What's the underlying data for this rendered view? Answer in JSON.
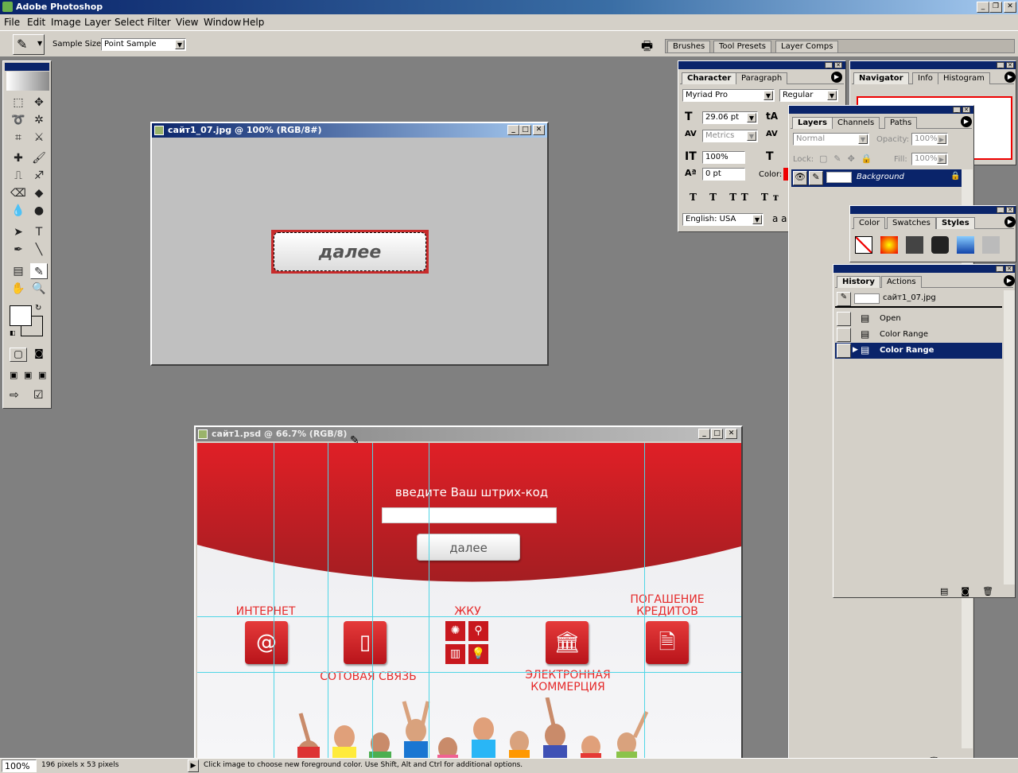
{
  "app": {
    "title": "Adobe Photoshop"
  },
  "menu": [
    "File",
    "Edit",
    "Image",
    "Layer",
    "Select",
    "Filter",
    "View",
    "Window",
    "Help"
  ],
  "options": {
    "sample_size_label": "Sample Size:",
    "sample_size_value": "Point Sample"
  },
  "dock_tabs": [
    "Brushes",
    "Tool Presets",
    "Layer Comps"
  ],
  "doc1": {
    "title": "сайт1_07.jpg @ 100% (RGB/8#)",
    "button_text": "далее"
  },
  "doc2": {
    "title": "сайт1.psd @ 66.7% (RGB/8)",
    "heading": "введите Ваш штрих-код",
    "button_text": "далее",
    "services": {
      "internet": "ИНТЕРНЕТ",
      "mobile": "СОТОВАЯ СВЯЗЬ",
      "zhku": "ЖКУ",
      "credit": "ПОГАШЕНИЕ\nКРЕДИТОВ",
      "ecommerce": "ЭЛЕКТРОННАЯ\nКОММЕРЦИЯ"
    }
  },
  "character": {
    "tabs": [
      "Character",
      "Paragraph"
    ],
    "font": "Myriad Pro",
    "style": "Regular",
    "size": "29.06 pt",
    "kerning": "Metrics",
    "vscale": "100%",
    "baseline": "0 pt",
    "color_label": "Color:",
    "language": "English: USA",
    "aa": "a a"
  },
  "navigator": {
    "tabs": [
      "Navigator",
      "Info",
      "Histogram"
    ]
  },
  "layers": {
    "tabs": [
      "Layers",
      "Channels",
      "Paths"
    ],
    "blend": "Normal",
    "opacity_label": "Opacity:",
    "opacity": "100%",
    "lock_label": "Lock:",
    "fill_label": "Fill:",
    "fill": "100%",
    "layer_name": "Background"
  },
  "styles": {
    "tabs": [
      "Color",
      "Swatches",
      "Styles"
    ]
  },
  "history": {
    "tabs": [
      "History",
      "Actions"
    ],
    "snapshot": "сайт1_07.jpg",
    "items": [
      "Open",
      "Color Range",
      "Color Range"
    ]
  },
  "status": {
    "zoom": "100%",
    "doc_size": "196 pixels x 53 pixels",
    "hint": "Click image to choose new foreground color.  Use Shift, Alt and Ctrl for additional options."
  },
  "colors": {
    "accent_red": "#e52a2a",
    "title_blue": "#0a246a"
  }
}
